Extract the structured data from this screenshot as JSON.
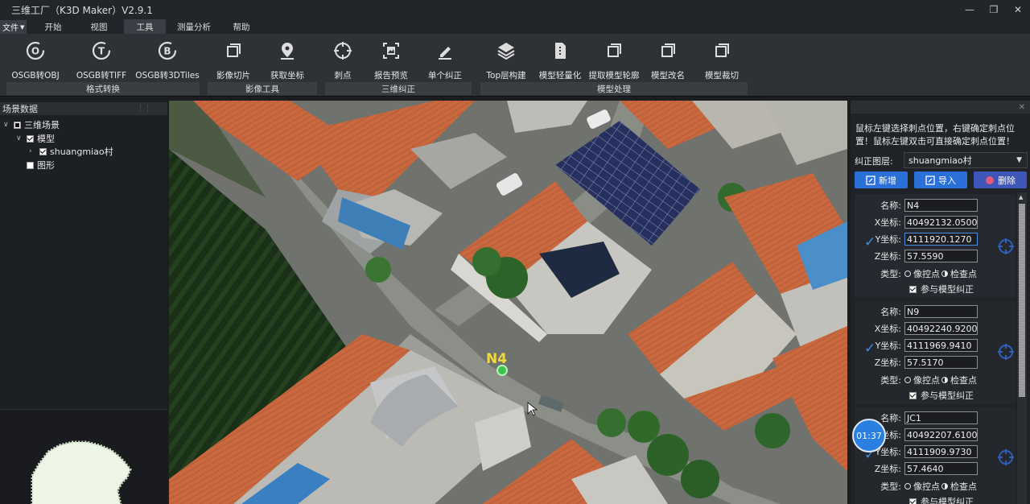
{
  "window": {
    "title": "三维工厂（K3D Maker）V2.9.1",
    "minimize_icon": "—",
    "restore_icon": "❐",
    "close_icon": "✕"
  },
  "menu": {
    "file": "文件",
    "tabs": [
      "开始",
      "视图",
      "工具",
      "测量分析",
      "帮助"
    ],
    "active_tab": "工具"
  },
  "ribbon": {
    "buttons": [
      {
        "label": "OSGB转OBJ",
        "icon": "osgb-obj-icon"
      },
      {
        "label": "OSGB转TIFF",
        "icon": "osgb-tiff-icon"
      },
      {
        "label": "OSGB转3DTiles",
        "icon": "osgb-3dtiles-icon"
      },
      {
        "label": "影像切片",
        "icon": "image-slice-icon"
      },
      {
        "label": "获取坐标",
        "icon": "location-pin-icon"
      },
      {
        "label": "刺点",
        "icon": "crosshair-icon"
      },
      {
        "label": "报告预览",
        "icon": "report-preview-icon"
      },
      {
        "label": "单个纠正",
        "icon": "pen-icon"
      },
      {
        "label": "Top层构建",
        "icon": "layers-icon"
      },
      {
        "label": "模型轻量化",
        "icon": "lightweight-icon"
      },
      {
        "label": "提取模型轮廓",
        "icon": "contour-icon"
      },
      {
        "label": "模型改名",
        "icon": "rename-icon"
      },
      {
        "label": "模型裁切",
        "icon": "clip-icon"
      }
    ],
    "groups": [
      "格式转换",
      "影像工具",
      "三维纠正",
      "模型处理"
    ]
  },
  "scene": {
    "title": "场景数据",
    "root": "三维场景",
    "model": "模型",
    "village": "shuangmiao村",
    "shape": "图形"
  },
  "viewport": {
    "marker_label": "N4"
  },
  "gcp_panel": {
    "hint": "鼠标左键选择刺点位置，右键确定刺点位置！鼠标左键双击可直接确定刺点位置！",
    "layer_label": "纠正图层:",
    "layer_value": "shuangmiao村",
    "add_label": "新增",
    "import_label": "导入",
    "delete_label": "删除",
    "field_labels": {
      "name": "名称:",
      "x": "X坐标:",
      "y": "Y坐标:",
      "z": "Z坐标:",
      "type": "类型:",
      "ctrl": "像控点",
      "check": "检查点",
      "participate": "参与模型纠正"
    },
    "points": [
      {
        "name": "N4",
        "x": "40492132.0500",
        "y": "4111920.1270",
        "z": "57.5590"
      },
      {
        "name": "N9",
        "x": "40492240.9200",
        "y": "4111969.9410",
        "z": "57.5170"
      },
      {
        "name": "JC1",
        "x": "40492207.6100",
        "y": "4111909.9730",
        "z": "57.4640"
      }
    ]
  },
  "timer": "01:37",
  "colors": {
    "accent": "#2b6fd8",
    "panel": "#1f2226",
    "ribbon": "#2e3136"
  }
}
